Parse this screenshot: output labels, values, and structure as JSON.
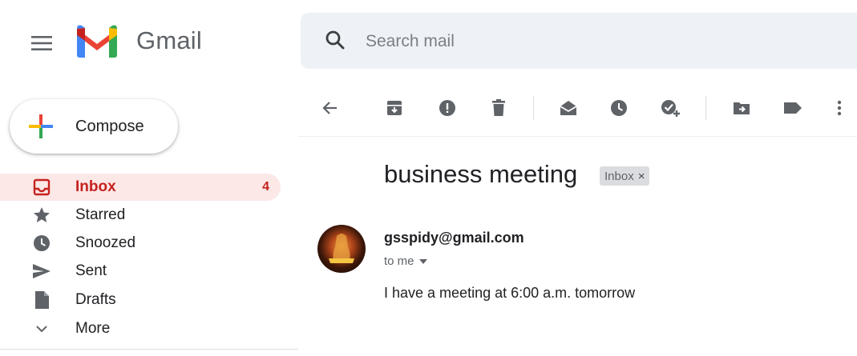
{
  "app": {
    "name": "Gmail"
  },
  "search": {
    "placeholder": "Search mail",
    "value": ""
  },
  "compose": {
    "label": "Compose"
  },
  "sidebar": {
    "items": [
      {
        "label": "Inbox",
        "icon": "inbox-icon",
        "count": "4",
        "active": true
      },
      {
        "label": "Starred",
        "icon": "star-icon",
        "count": "",
        "active": false
      },
      {
        "label": "Snoozed",
        "icon": "clock-icon",
        "count": "",
        "active": false
      },
      {
        "label": "Sent",
        "icon": "send-icon",
        "count": "",
        "active": false
      },
      {
        "label": "Drafts",
        "icon": "draft-icon",
        "count": "",
        "active": false
      },
      {
        "label": "More",
        "icon": "chevron-down-icon",
        "count": "",
        "active": false
      }
    ]
  },
  "toolbar": {
    "icons": [
      "back-arrow-icon",
      "archive-icon",
      "report-spam-icon",
      "delete-icon",
      "mark-unread-icon",
      "snooze-icon",
      "add-to-tasks-icon",
      "move-to-icon",
      "label-icon",
      "more-vert-icon"
    ]
  },
  "message": {
    "subject": "business meeting",
    "label_chip": "Inbox",
    "chip_close": "×",
    "sender": "gsspidy@gmail.com",
    "recipient": "to me",
    "body": "I have a meeting at 6:00 a.m. tomorrow"
  },
  "colors": {
    "active_bg": "#fce8e6",
    "active_text": "#c5221f",
    "search_bg": "#eef1f5",
    "icon_gray": "#5f6368"
  }
}
